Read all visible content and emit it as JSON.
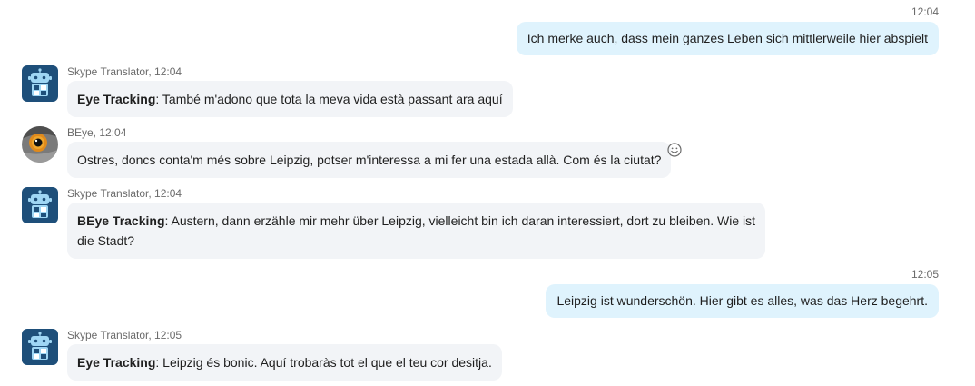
{
  "messages": {
    "m1": {
      "time": "12:04",
      "text": "Ich merke auch, dass mein ganzes Leben sich mittlerweile hier abspielt"
    },
    "m2": {
      "sender": "Skype Translator, 12:04",
      "name": "Eye Tracking",
      "text": ": També m'adono que tota la meva vida està passant ara aquí"
    },
    "m3": {
      "sender": "BEye, 12:04",
      "text": "Ostres, doncs conta'm més sobre Leipzig, potser m'interessa a mi fer una estada allà. Com és la ciutat?"
    },
    "m4": {
      "sender": "Skype Translator, 12:04",
      "name": "BEye Tracking",
      "text1": ": Austern, dann erzähle mir mehr über Leipzig, vielleicht bin ich daran interessiert, dort zu bleiben. Wie ist",
      "text2": "die Stadt?"
    },
    "m5": {
      "time": "12:05",
      "text": "Leipzig ist wunderschön. Hier gibt es alles, was das Herz begehrt."
    },
    "m6": {
      "sender": "Skype Translator, 12:05",
      "name": "Eye Tracking",
      "text": ": Leipzig és bonic. Aquí trobaràs tot el que el teu cor desitja."
    }
  },
  "icons": {
    "bot_avatar": "skype-translator-bot-icon",
    "user_avatar": "owl-eye-avatar",
    "reaction": "smiley-reaction-icon"
  },
  "colors": {
    "outgoing_bubble": "#dff3fd",
    "incoming_bubble": "#f2f4f7",
    "bot_avatar_bg": "#1e4f7a"
  }
}
